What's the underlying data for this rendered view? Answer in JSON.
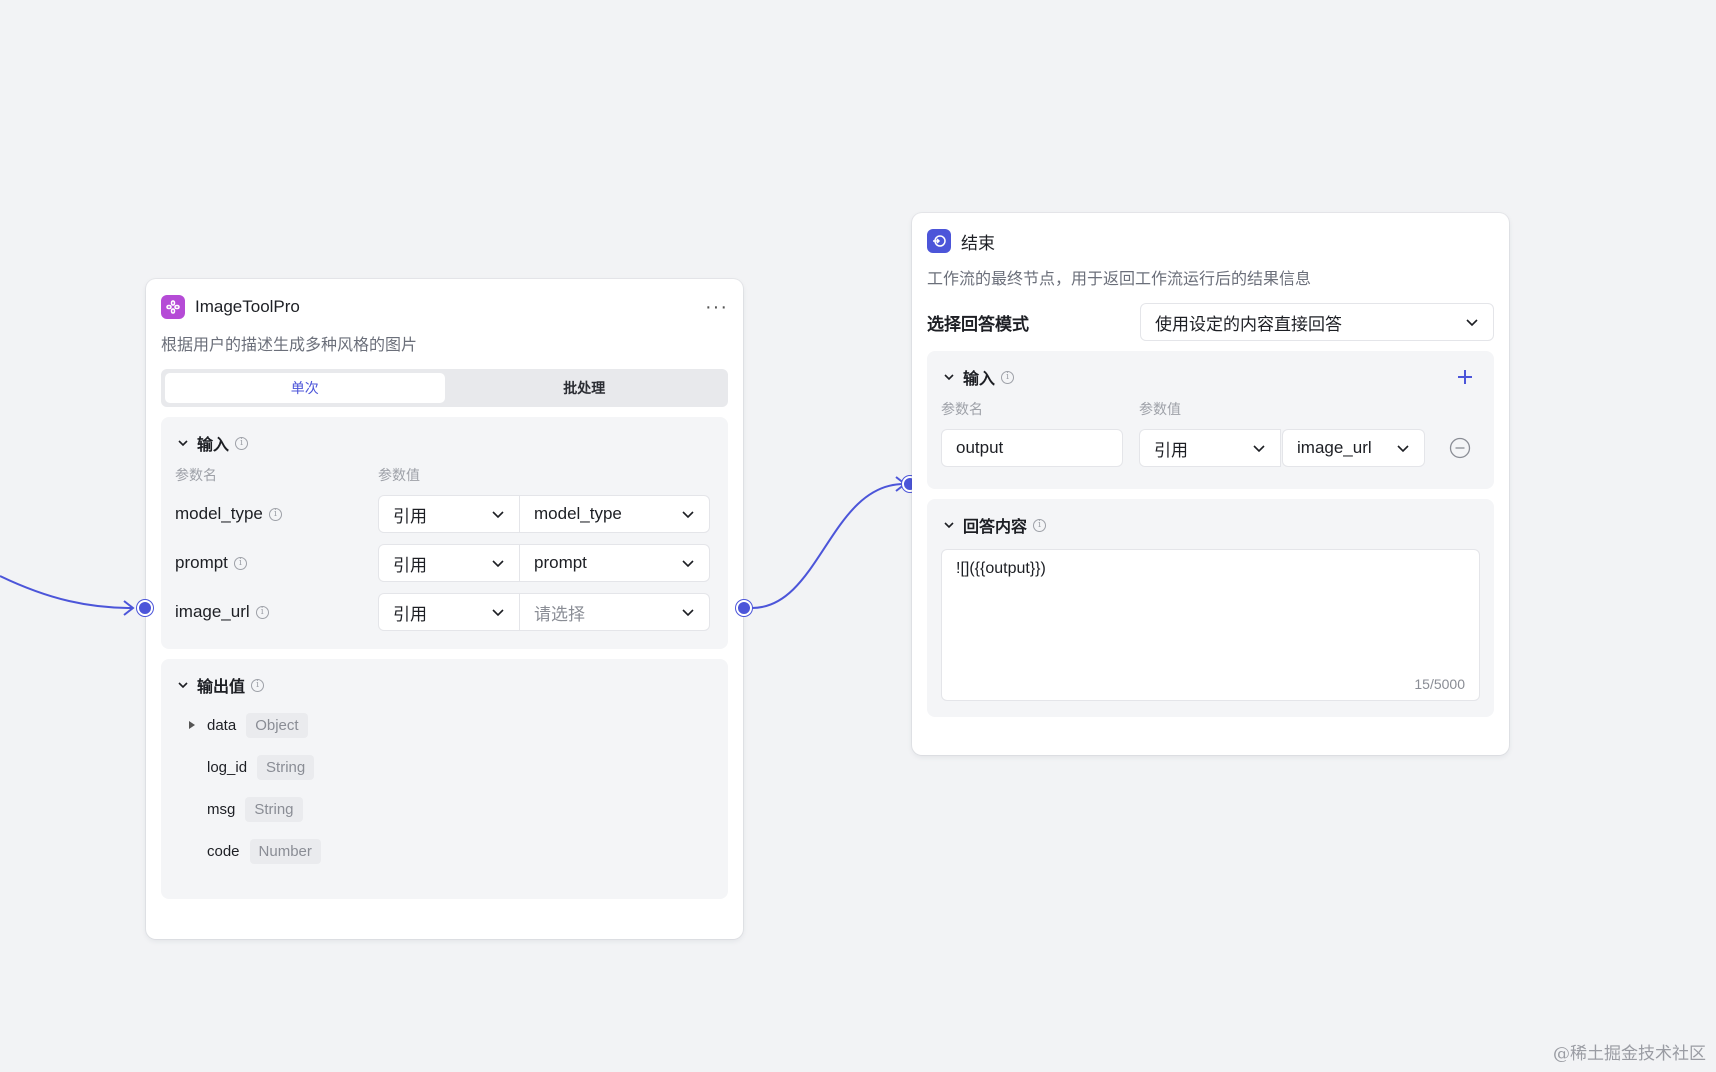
{
  "colors": {
    "accent": "#4c55d9",
    "canvas": "#f2f3f5",
    "plugin_icon": "#b54bd6"
  },
  "plugin_node": {
    "title": "ImageToolPro",
    "description": "根据用户的描述生成多种风格的图片",
    "more_label": "···",
    "tabs": [
      {
        "label": "单次",
        "active": true
      },
      {
        "label": "批处理",
        "active": false
      }
    ],
    "input_section": {
      "title": "输入",
      "col_name": "参数名",
      "col_value": "参数值",
      "rows": [
        {
          "name": "model_type",
          "mode": "引用",
          "value": "model_type",
          "placeholder": false
        },
        {
          "name": "prompt",
          "mode": "引用",
          "value": "prompt",
          "placeholder": false
        },
        {
          "name": "image_url",
          "mode": "引用",
          "value": "请选择",
          "placeholder": true
        }
      ]
    },
    "output_section": {
      "title": "输出值",
      "items": [
        {
          "name": "data",
          "type": "Object",
          "expandable": true
        },
        {
          "name": "log_id",
          "type": "String",
          "expandable": false
        },
        {
          "name": "msg",
          "type": "String",
          "expandable": false
        },
        {
          "name": "code",
          "type": "Number",
          "expandable": false
        }
      ]
    }
  },
  "end_node": {
    "title": "结束",
    "description": "工作流的最终节点，用于返回工作流运行后的结果信息",
    "mode_label": "选择回答模式",
    "mode_value": "使用设定的内容直接回答",
    "input_section": {
      "title": "输入",
      "col_name": "参数名",
      "col_value": "参数值",
      "row": {
        "name": "output",
        "mode": "引用",
        "value": "image_url"
      }
    },
    "answer_section": {
      "title": "回答内容",
      "content": "![]({{output}})",
      "counter": "15/5000"
    }
  },
  "watermark": "@稀土掘金技术社区"
}
